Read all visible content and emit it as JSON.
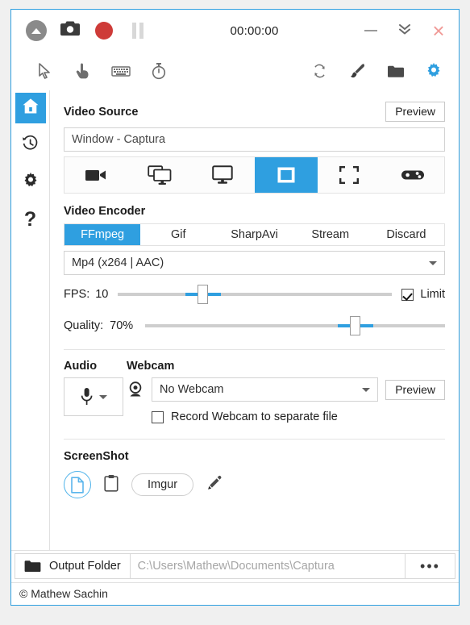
{
  "titlebar": {
    "collapse_icon": "circle-up-arrow-icon",
    "screenshot_icon": "camera-icon",
    "record_icon": "record-dot-icon",
    "pause_icon": "pause-icon",
    "timer": "00:00:00",
    "minimize_icon": "minimize-icon",
    "hide_icon": "double-chevron-down-icon",
    "close_icon": "close-icon",
    "close_glyph": "×"
  },
  "toolbar": {
    "left_tools": [
      {
        "name": "cursor-icon",
        "label": "Cursor"
      },
      {
        "name": "clicks-icon",
        "label": "Clicks"
      },
      {
        "name": "keystrokes-icon",
        "label": "Keystrokes"
      },
      {
        "name": "timer-icon",
        "label": "Timer"
      }
    ],
    "right_tools": [
      {
        "name": "refresh-icon",
        "label": "Refresh"
      },
      {
        "name": "brush-icon",
        "label": "Brush"
      },
      {
        "name": "folder-icon",
        "label": "Folder"
      },
      {
        "name": "gear-icon",
        "label": "Settings"
      }
    ]
  },
  "sidebar": {
    "items": [
      {
        "name": "sidebar-item-home",
        "icon": "home-icon",
        "active": true
      },
      {
        "name": "sidebar-item-history",
        "icon": "history-clock-icon",
        "active": false
      },
      {
        "name": "sidebar-item-settings",
        "icon": "gear-icon",
        "active": false
      },
      {
        "name": "sidebar-item-help",
        "icon": "question-mark-icon",
        "active": false
      }
    ],
    "help_glyph": "?"
  },
  "video_source": {
    "title": "Video Source",
    "preview_label": "Preview",
    "selected": "Window  -  Captura",
    "modes": [
      {
        "name": "source-mode-video-device",
        "icon": "video-camera-icon",
        "active": false
      },
      {
        "name": "source-mode-desktop-duplication",
        "icon": "multi-monitor-icon",
        "active": false
      },
      {
        "name": "source-mode-screen",
        "icon": "monitor-icon",
        "active": false
      },
      {
        "name": "source-mode-window",
        "icon": "window-icon",
        "active": true
      },
      {
        "name": "source-mode-region",
        "icon": "crop-region-icon",
        "active": false
      },
      {
        "name": "source-mode-game",
        "icon": "gamepad-icon",
        "active": false
      }
    ]
  },
  "video_encoder": {
    "title": "Video Encoder",
    "tabs": [
      {
        "label": "FFmpeg",
        "active": true
      },
      {
        "label": "Gif",
        "active": false
      },
      {
        "label": "SharpAvi",
        "active": false
      },
      {
        "label": "Stream",
        "active": false
      },
      {
        "label": "Discard",
        "active": false
      }
    ],
    "format": "Mp4 (x264 | AAC)",
    "fps_label": "FPS:",
    "fps_value": "10",
    "fps_percent": 31,
    "limit_label": "Limit",
    "limit_checked": true,
    "quality_label": "Quality:",
    "quality_value": "70%",
    "quality_percent": 70
  },
  "audio": {
    "title": "Audio",
    "mic_icon": "microphone-icon",
    "dropdown_icon": "chevron-down-icon"
  },
  "webcam": {
    "title": "Webcam",
    "icon": "webcam-icon",
    "selected": "No Webcam",
    "preview_label": "Preview",
    "record_separate_label": "Record Webcam to separate file",
    "record_separate_checked": false
  },
  "screenshot": {
    "title": "ScreenShot",
    "targets": [
      {
        "name": "screenshot-target-disk",
        "icon": "file-icon",
        "active": true
      },
      {
        "name": "screenshot-target-clipboard",
        "icon": "clipboard-icon",
        "active": false
      }
    ],
    "imgur_label": "Imgur",
    "edit_icon": "pencil-icon"
  },
  "footer": {
    "folder_icon": "folder-icon",
    "output_folder_label": "Output Folder",
    "output_path": "C:\\Users\\Mathew\\Documents\\Captura",
    "more_label": "•••",
    "credit": "© Mathew Sachin"
  },
  "colors": {
    "accent": "#2f9fe0",
    "record": "#ce3b38",
    "close": "#f09a97",
    "border": "#d2d2d2"
  }
}
